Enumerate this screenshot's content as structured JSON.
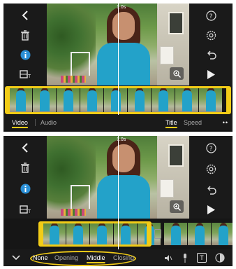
{
  "top": {
    "timecode": "1.0s",
    "tabs": [
      {
        "label": "Video",
        "active": true
      },
      {
        "label": "Audio",
        "active": false
      },
      {
        "label": "Title",
        "active": true
      },
      {
        "label": "Speed",
        "active": false
      }
    ],
    "more": "••"
  },
  "bottom": {
    "timecode": "1.0s",
    "title_styles": [
      {
        "label": "None",
        "active": false
      },
      {
        "label": "Opening",
        "active": false
      },
      {
        "label": "Middle",
        "active": true
      },
      {
        "label": "Closing",
        "active": false
      }
    ],
    "title_tool_glyph": "T"
  },
  "colors": {
    "accent": "#f2cc17",
    "info": "#2a8fd6",
    "shirt": "#23a2c9"
  },
  "icons": [
    "back-icon",
    "trash-icon",
    "info-icon",
    "titles-icon",
    "help-icon",
    "settings-icon",
    "undo-icon",
    "play-icon",
    "zoom-icon",
    "collapse-icon",
    "volume-icon",
    "mic-icon",
    "title-icon",
    "filter-icon"
  ]
}
